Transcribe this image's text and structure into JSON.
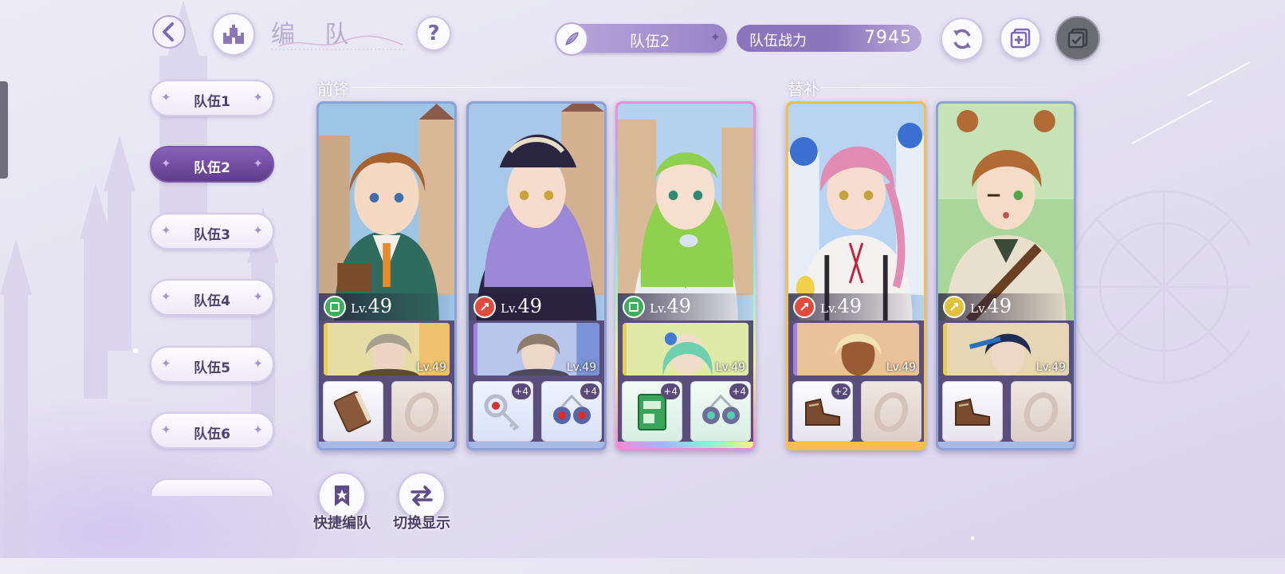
{
  "header": {
    "title": "编 队",
    "current_team": "队伍2",
    "power_label": "队伍战力",
    "power_value": "7945",
    "help_symbol": "?"
  },
  "icons": {
    "back": "back-arrow-icon",
    "castle": "castle-icon",
    "help": "question-icon",
    "feather": "feather-icon",
    "refresh": "refresh-icon",
    "add": "add-copy-icon",
    "check": "checklist-icon",
    "quick": "bookmark-star-icon",
    "switch": "swap-arrows-icon"
  },
  "sidebar": {
    "teams": [
      {
        "label": "队伍1",
        "active": false
      },
      {
        "label": "队伍2",
        "active": true
      },
      {
        "label": "队伍3",
        "active": false
      },
      {
        "label": "队伍4",
        "active": false
      },
      {
        "label": "队伍5",
        "active": false
      },
      {
        "label": "队伍6",
        "active": false
      },
      {
        "label": "",
        "active": false
      }
    ]
  },
  "sections": {
    "front": "前锋",
    "sub": "替补"
  },
  "cards": [
    {
      "level_prefix": "Lv.",
      "level": "49",
      "element_color": "#3fae5a",
      "partner_level": "Lv.49",
      "gear": [
        {
          "icon": "book-icon",
          "plus": ""
        },
        {
          "icon": "ring-icon",
          "plus": ""
        }
      ]
    },
    {
      "level_prefix": "Lv.",
      "level": "49",
      "element_color": "#e24b3b",
      "partner_level": "Lv.49",
      "gear": [
        {
          "icon": "key-pendant-icon",
          "plus": "+4"
        },
        {
          "icon": "earrings-icon",
          "plus": "+4"
        }
      ]
    },
    {
      "level_prefix": "Lv.",
      "level": "49",
      "element_color": "#3fae5a",
      "partner_level": "Lv.49",
      "gear": [
        {
          "icon": "green-book-icon",
          "plus": "+4"
        },
        {
          "icon": "earrings-icon",
          "plus": "+4"
        }
      ]
    },
    {
      "level_prefix": "Lv.",
      "level": "49",
      "element_color": "#e24b3b",
      "partner_level": "Lv.49",
      "gear": [
        {
          "icon": "boots-icon",
          "plus": "+2"
        },
        {
          "icon": "ring-icon",
          "plus": ""
        }
      ]
    },
    {
      "level_prefix": "Lv.",
      "level": "49",
      "element_color": "#e0c23a",
      "partner_level": "Lv.49",
      "gear": [
        {
          "icon": "boots-icon",
          "plus": ""
        },
        {
          "icon": "ring-icon",
          "plus": ""
        }
      ]
    }
  ],
  "actions": {
    "quick": "快捷编队",
    "switch": "切换显示"
  }
}
